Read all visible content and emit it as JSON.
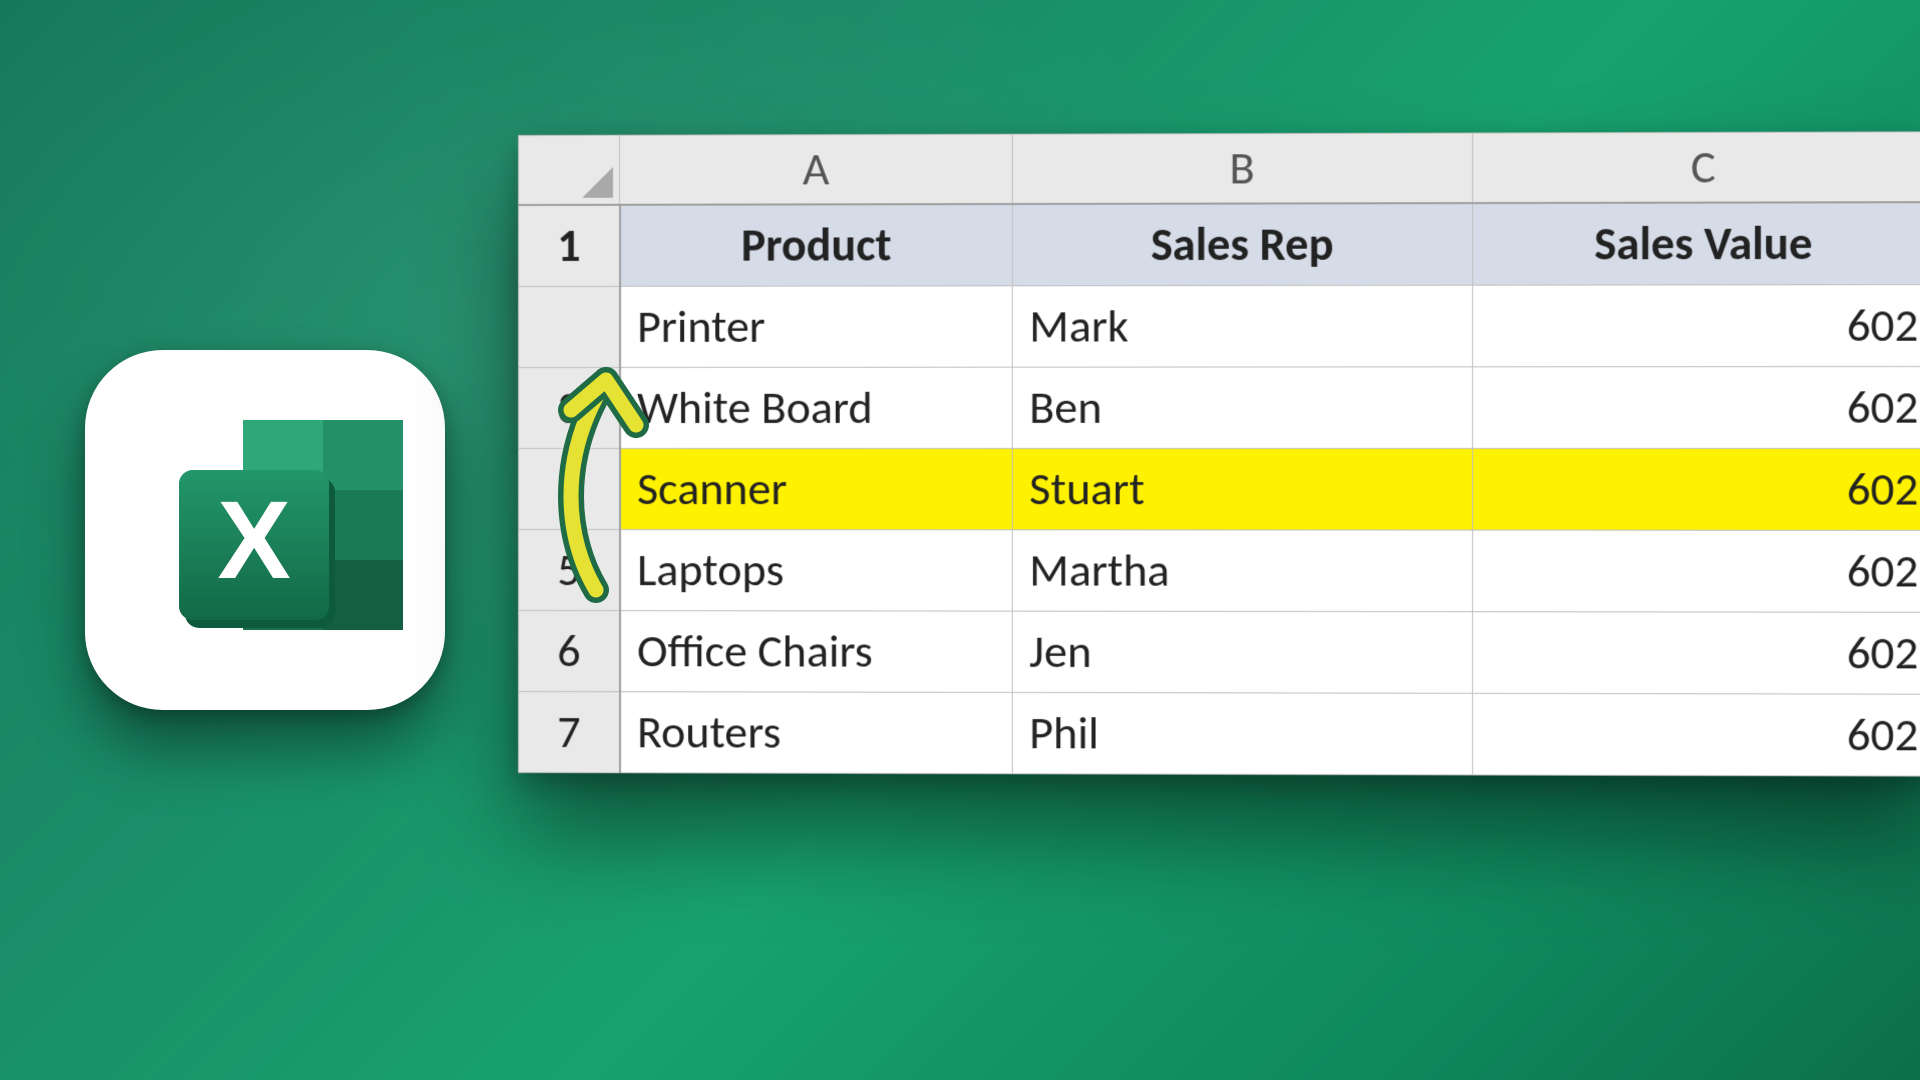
{
  "icon": {
    "letter": "X"
  },
  "sheet": {
    "columns": [
      "A",
      "B",
      "C"
    ],
    "row_nums": [
      "1",
      "",
      "3",
      "",
      "5",
      "6",
      "7"
    ],
    "headers": [
      "Product",
      "Sales Rep",
      "Sales Value"
    ],
    "highlight_row_index": 2,
    "rows": [
      {
        "product": "Printer",
        "sales_rep": "Mark",
        "sales_value": "602"
      },
      {
        "product": "White Board",
        "sales_rep": "Ben",
        "sales_value": "602"
      },
      {
        "product": "Scanner",
        "sales_rep": "Stuart",
        "sales_value": "602"
      },
      {
        "product": "Laptops",
        "sales_rep": "Martha",
        "sales_value": "602"
      },
      {
        "product": "Office Chairs",
        "sales_rep": "Jen",
        "sales_value": "602"
      },
      {
        "product": "Routers",
        "sales_rep": "Phil",
        "sales_value": "602"
      }
    ]
  }
}
